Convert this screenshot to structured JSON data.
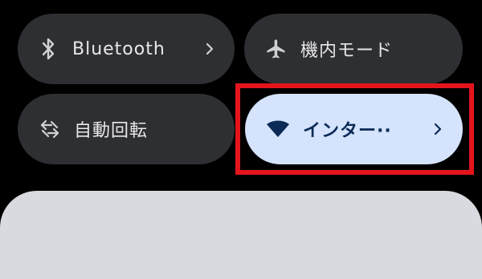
{
  "quick_settings": {
    "tiles": [
      {
        "id": "bluetooth",
        "label": "Bluetooth",
        "icon": "bluetooth-icon",
        "has_chevron": true,
        "active": false
      },
      {
        "id": "airplane",
        "label": "機内モード",
        "icon": "airplane-icon",
        "has_chevron": false,
        "active": false
      },
      {
        "id": "auto_rotate",
        "label": "自動回転",
        "icon": "rotate-icon",
        "has_chevron": false,
        "active": false
      },
      {
        "id": "internet",
        "label": "インター··",
        "icon": "wifi-icon",
        "has_chevron": true,
        "active": true
      }
    ]
  },
  "colors": {
    "background": "#000000",
    "tile_inactive": "#2e2f33",
    "tile_active": "#d5e3fd",
    "text_inactive": "#e8e8ea",
    "text_active": "#0b2a55",
    "highlight": "#e3141b",
    "panel": "#d9dadf"
  }
}
